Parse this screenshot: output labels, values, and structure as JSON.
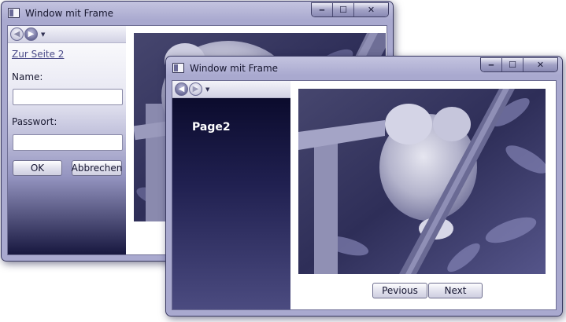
{
  "back_window": {
    "title": "Window mit Frame",
    "caption": {
      "minimize": "‒",
      "maximize": "☐",
      "close": "✕"
    },
    "nav": {
      "back_glyph": "◀",
      "forward_glyph": "▶",
      "dropdown_glyph": "▼"
    },
    "page": {
      "link_text": "Zur Seite 2",
      "name_label": "Name:",
      "name_value": "",
      "password_label": "Passwort:",
      "password_value": "",
      "ok_label": "OK",
      "cancel_label": "Abbrechen"
    }
  },
  "front_window": {
    "title": "Window mit Frame",
    "caption": {
      "minimize": "‒",
      "maximize": "☐",
      "close": "✕"
    },
    "nav": {
      "back_glyph": "◀",
      "forward_glyph": "▶",
      "dropdown_glyph": "▼"
    },
    "page": {
      "title": "Page2",
      "previous_label": "Pevious",
      "next_label": "Next"
    }
  },
  "colors": {
    "panel_dark": "#17173f",
    "tint": "#a9a9cf",
    "link": "#4a4a88"
  }
}
